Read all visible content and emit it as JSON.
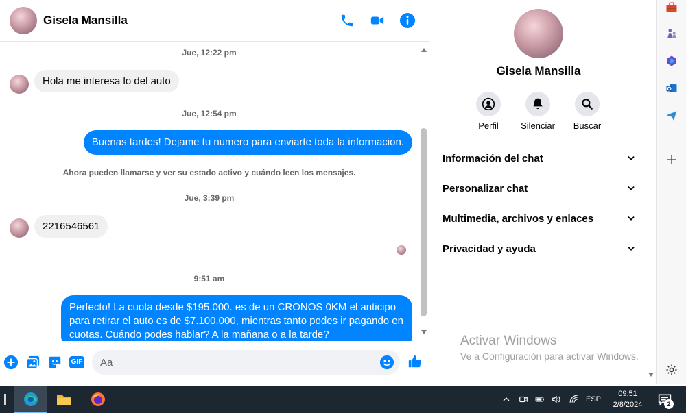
{
  "contact": {
    "name": "Gisela Mansilla"
  },
  "messages": {
    "ts1": "Jue, 12:22 pm",
    "in1": "Hola me interesa lo del auto",
    "ts2": "Jue, 12:54 pm",
    "out1": "Buenas tardes! Dejame tu numero para enviarte toda la informacion.",
    "system": "Ahora pueden llamarse y ver su estado activo y cuándo leen los mensajes.",
    "ts3": "Jue, 3:39 pm",
    "in2": "2216546561",
    "ts4": "9:51 am",
    "out2": "Perfecto! La cuota desde $195.000. es de un CRONOS 0KM el anticipo para retirar el auto es de $7.100.000, mientras tanto podes ir pagando en cuotas. Cuándo podes hablar? A la mañana o a la tarde?"
  },
  "composer": {
    "placeholder": "Aa",
    "gif_label": "GIF"
  },
  "info": {
    "actions": [
      {
        "label": "Perfil",
        "icon": "profile-icon"
      },
      {
        "label": "Silenciar",
        "icon": "bell-icon"
      },
      {
        "label": "Buscar",
        "icon": "search-icon"
      }
    ],
    "sections": [
      "Información del chat",
      "Personalizar chat",
      "Multimedia, archivos y enlaces",
      "Privacidad y ayuda"
    ],
    "watermark_title": "Activar Windows",
    "watermark_sub": "Ve a Configuración para activar Windows."
  },
  "taskbar": {
    "lang": "ESP",
    "time": "09:51",
    "date": "2/8/2024",
    "notifications": "2"
  },
  "colors": {
    "messenger_blue": "#0084ff",
    "bubble_gray": "#f0f0f0",
    "taskbar": "#1c2732"
  }
}
